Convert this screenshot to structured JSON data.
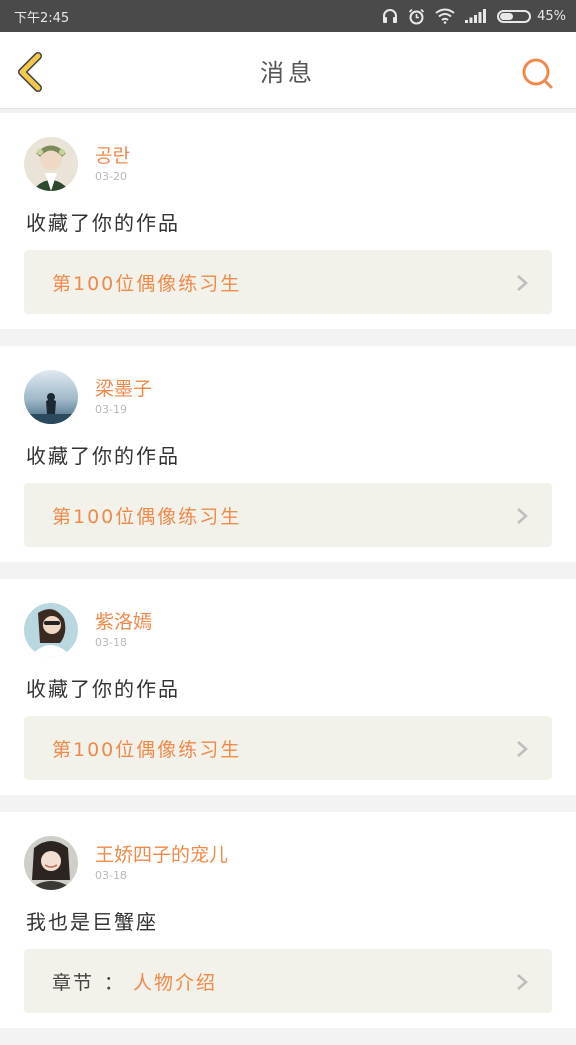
{
  "status_bar": {
    "time": "下午2:45",
    "battery_percent": "45%",
    "battery_level": 0.45,
    "icons": [
      "headphones-icon",
      "alarm-icon",
      "wifi-icon",
      "signal-icon",
      "battery-icon"
    ]
  },
  "header": {
    "title": "消息",
    "back_icon": "chevron-left-icon",
    "search_icon": "search-icon"
  },
  "colors": {
    "accent": "#f08a4b",
    "back_arrow": "#f2c94c",
    "card_link_bg": "#f3f2ea"
  },
  "messages": [
    {
      "name": "공란",
      "date": "03-20",
      "text": "收藏了你的作品",
      "link_prefix": "",
      "link_title": "第100位偶像练习生"
    },
    {
      "name": "梁墨子",
      "date": "03-19",
      "text": "收藏了你的作品",
      "link_prefix": "",
      "link_title": "第100位偶像练习生"
    },
    {
      "name": "紫洛嫣",
      "date": "03-18",
      "text": "收藏了你的作品",
      "link_prefix": "",
      "link_title": "第100位偶像练习生"
    },
    {
      "name": "王娇四子的宠儿",
      "date": "03-18",
      "text": "我也是巨蟹座",
      "link_prefix": "章节",
      "link_sep": "：",
      "link_title": "人物介绍"
    }
  ]
}
